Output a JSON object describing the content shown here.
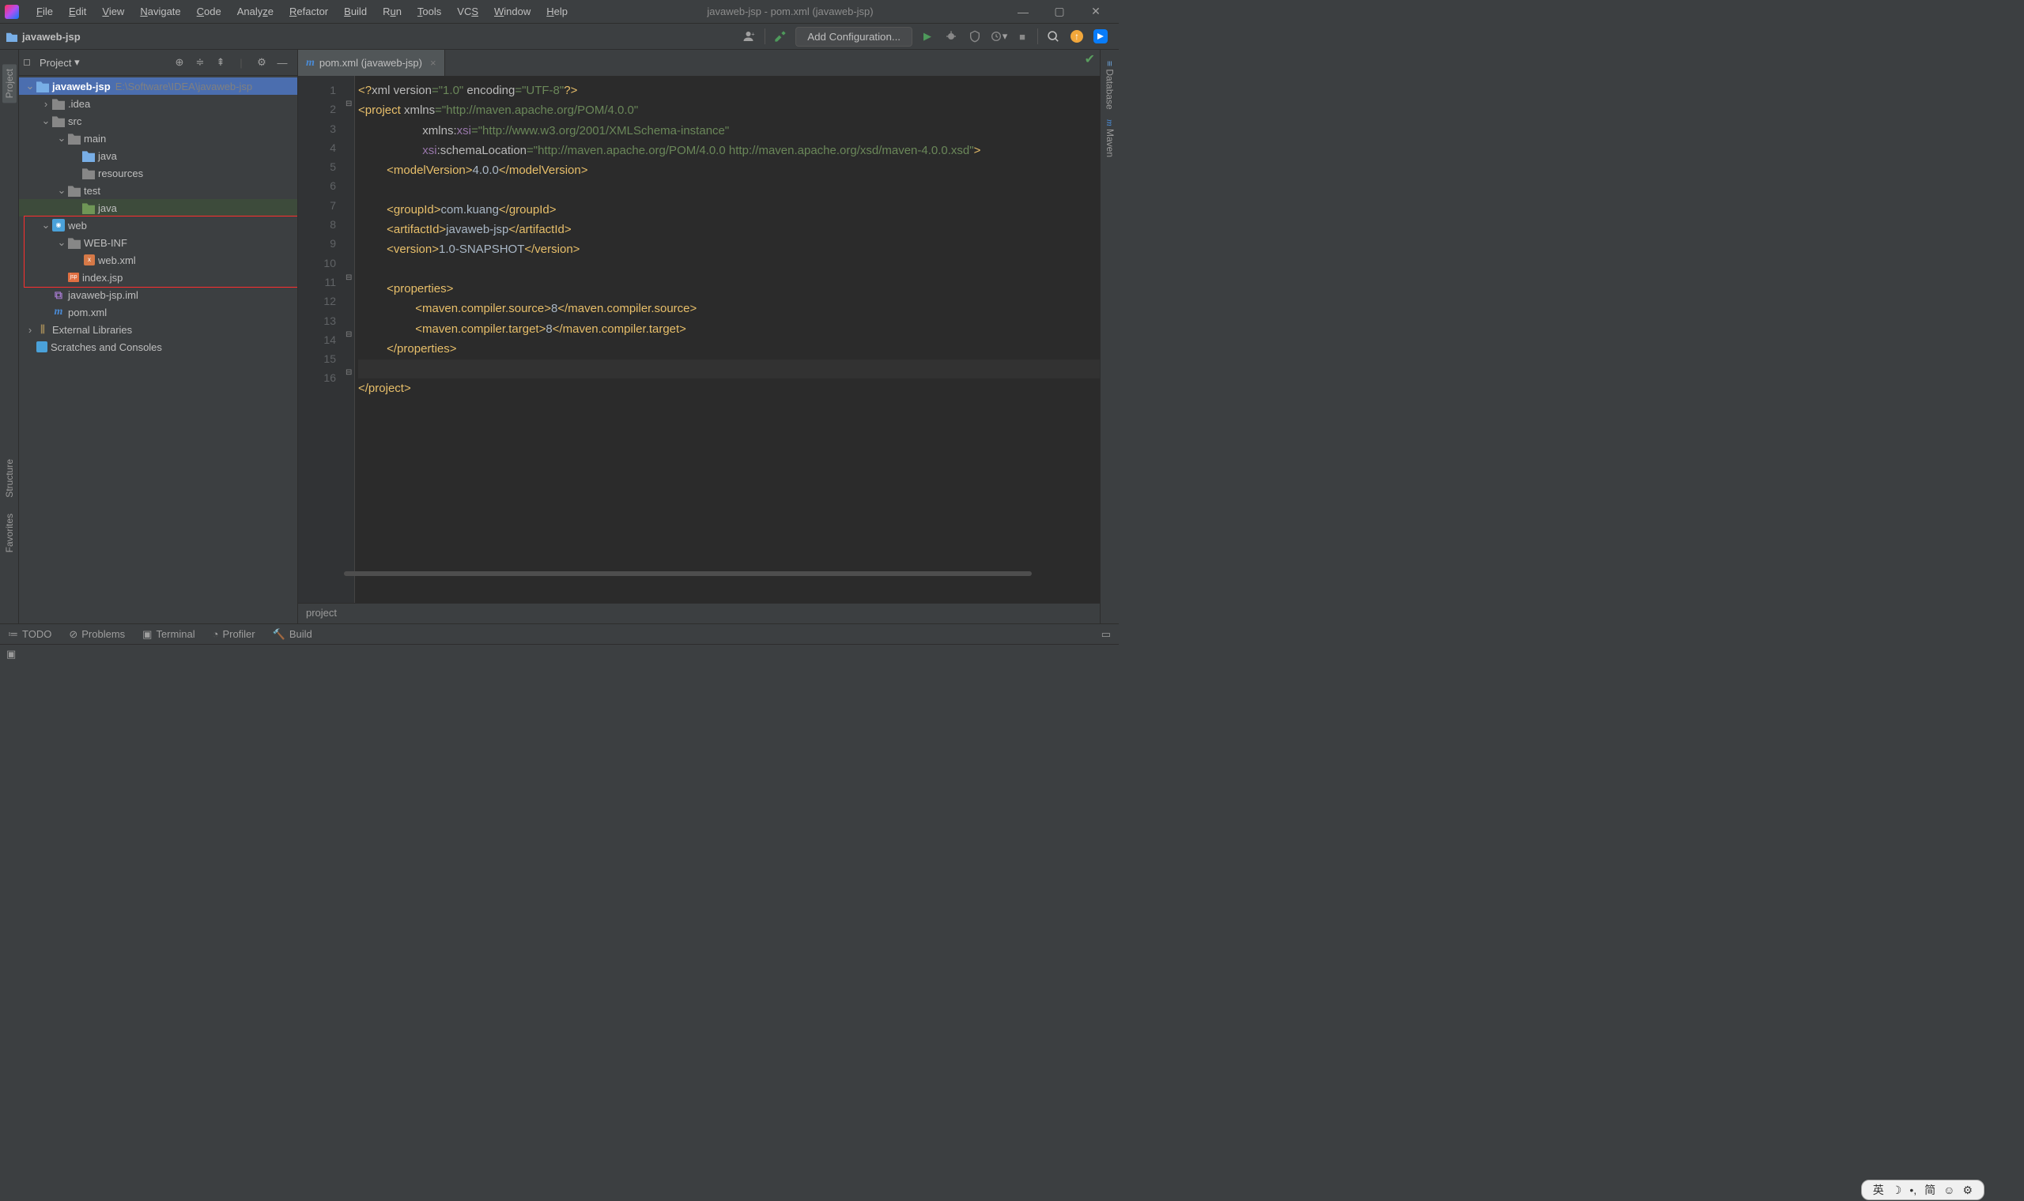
{
  "window_title": "javaweb-jsp - pom.xml (javaweb-jsp)",
  "menu": [
    "File",
    "Edit",
    "View",
    "Navigate",
    "Code",
    "Analyze",
    "Refactor",
    "Build",
    "Run",
    "Tools",
    "VCS",
    "Window",
    "Help"
  ],
  "nav_crumb": "javaweb-jsp",
  "config_btn": "Add Configuration...",
  "proj_header": "Project",
  "left_tabs": {
    "project": "Project",
    "structure": "Structure",
    "favorites": "Favorites"
  },
  "right_tabs": {
    "database": "Database",
    "maven": "Maven"
  },
  "tree": {
    "root": {
      "name": "javaweb-jsp",
      "path": "E:\\Software\\IDEA\\javaweb-jsp"
    },
    "idea": ".idea",
    "src": "src",
    "main": "main",
    "java": "java",
    "resources": "resources",
    "test": "test",
    "java2": "java",
    "web": "web",
    "webinf": "WEB-INF",
    "webxml": "web.xml",
    "indexjsp": "index.jsp",
    "iml": "javaweb-jsp.iml",
    "pom": "pom.xml",
    "ext": "External Libraries",
    "scratch": "Scratches and Consoles"
  },
  "tab": {
    "label": "pom.xml (javaweb-jsp)"
  },
  "gutter_lines": [
    "1",
    "2",
    "3",
    "4",
    "5",
    "6",
    "7",
    "8",
    "9",
    "10",
    "11",
    "12",
    "13",
    "14",
    "15",
    "16"
  ],
  "code": {
    "l1": {
      "pre": "<?",
      "xml": "xml version",
      "eq": "=",
      "v": "\"1.0\"",
      "enc": " encoding",
      "eq2": "=",
      "e": "\"UTF-8\"",
      "end": "?>"
    },
    "l2": {
      "o": "<project ",
      "a": "xmlns",
      "eq": "=",
      "v": "\"http://maven.apache.org/POM/4.0.0\""
    },
    "l3": {
      "a": "xmlns:",
      "xsi": "xsi",
      "eq": "=",
      "v": "\"http://www.w3.org/2001/XMLSchema-instance\""
    },
    "l4": {
      "xsi": "xsi",
      "a": ":schemaLocation",
      "eq": "=",
      "v": "\"http://maven.apache.org/POM/4.0.0 http://maven.apache.org/xsd/maven-4.0.0.xsd\"",
      "c": ">"
    },
    "l5": {
      "o": "<modelVersion>",
      "v": "4.0.0",
      "c": "</modelVersion>"
    },
    "l7": {
      "o": "<groupId>",
      "v": "com.kuang",
      "c": "</groupId>"
    },
    "l8": {
      "o": "<artifactId>",
      "v": "javaweb-jsp",
      "c": "</artifactId>"
    },
    "l9": {
      "o": "<version>",
      "v": "1.0-SNAPSHOT",
      "c": "</version>"
    },
    "l11": {
      "o": "<properties>"
    },
    "l12": {
      "o": "<maven.compiler.source>",
      "v": "8",
      "c": "</maven.compiler.source>"
    },
    "l13": {
      "o": "<maven.compiler.target>",
      "v": "8",
      "c": "</maven.compiler.target>"
    },
    "l14": {
      "c": "</properties>"
    },
    "l16": {
      "c": "</project>"
    }
  },
  "breadcrumb": "project",
  "tool_windows": {
    "todo": "TODO",
    "problems": "Problems",
    "terminal": "Terminal",
    "profiler": "Profiler",
    "build": "Build"
  },
  "lang_float": {
    "a": "英",
    "b": "简"
  }
}
